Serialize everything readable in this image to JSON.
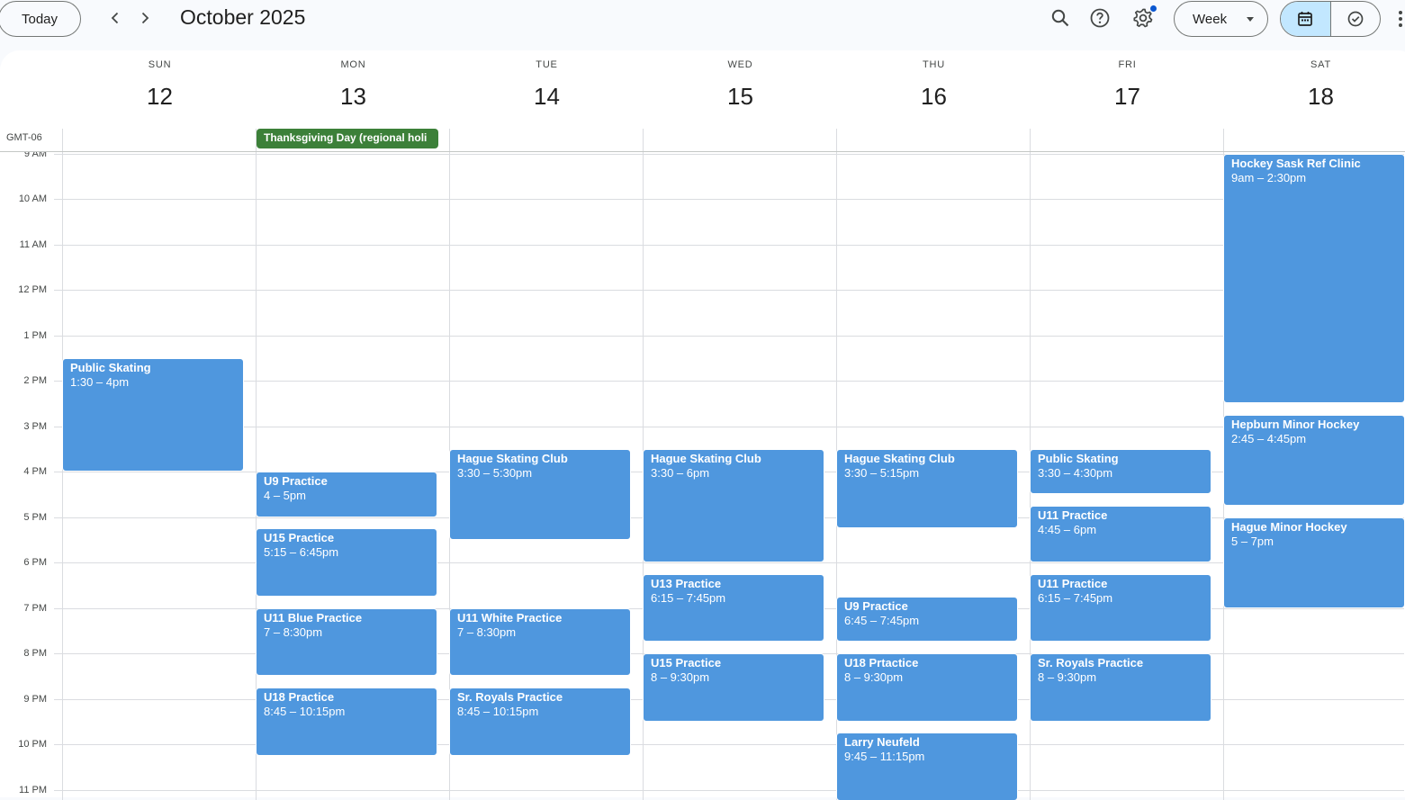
{
  "header": {
    "today_label": "Today",
    "month_title": "October 2025",
    "view_label": "Week"
  },
  "timezone": "GMT-06",
  "days": [
    {
      "dow": "SUN",
      "num": "12"
    },
    {
      "dow": "MON",
      "num": "13"
    },
    {
      "dow": "TUE",
      "num": "14"
    },
    {
      "dow": "WED",
      "num": "15"
    },
    {
      "dow": "THU",
      "num": "16"
    },
    {
      "dow": "FRI",
      "num": "17"
    },
    {
      "dow": "SAT",
      "num": "18"
    }
  ],
  "hours": [
    "9 AM",
    "10 AM",
    "11 AM",
    "12 PM",
    "1 PM",
    "2 PM",
    "3 PM",
    "4 PM",
    "5 PM",
    "6 PM",
    "7 PM",
    "8 PM",
    "9 PM",
    "10 PM",
    "11 PM"
  ],
  "all_day_events": [
    {
      "day": 1,
      "title": "Thanksgiving Day (regional holi",
      "color": "#3c8039"
    }
  ],
  "events": [
    {
      "day": 0,
      "title": "Public Skating",
      "time": "1:30 – 4pm",
      "start": 13.5,
      "end": 16.0
    },
    {
      "day": 1,
      "title": "U9 Practice",
      "time": "4 – 5pm",
      "start": 16.0,
      "end": 17.0
    },
    {
      "day": 1,
      "title": "U15 Practice",
      "time": "5:15 – 6:45pm",
      "start": 17.25,
      "end": 18.75
    },
    {
      "day": 1,
      "title": "U11 Blue Practice",
      "time": "7 – 8:30pm",
      "start": 19.0,
      "end": 20.5
    },
    {
      "day": 1,
      "title": "U18 Practice",
      "time": "8:45 – 10:15pm",
      "start": 20.75,
      "end": 22.25
    },
    {
      "day": 2,
      "title": "Hague Skating Club",
      "time": "3:30 – 5:30pm",
      "start": 15.5,
      "end": 17.5
    },
    {
      "day": 2,
      "title": "U11 White Practice",
      "time": "7 – 8:30pm",
      "start": 19.0,
      "end": 20.5
    },
    {
      "day": 2,
      "title": "Sr. Royals Practice",
      "time": "8:45 – 10:15pm",
      "start": 20.75,
      "end": 22.25
    },
    {
      "day": 3,
      "title": "Hague Skating Club",
      "time": "3:30 – 6pm",
      "start": 15.5,
      "end": 18.0
    },
    {
      "day": 3,
      "title": "U13 Practice",
      "time": "6:15 – 7:45pm",
      "start": 18.25,
      "end": 19.75
    },
    {
      "day": 3,
      "title": "U15 Practice",
      "time": "8 – 9:30pm",
      "start": 20.0,
      "end": 21.5
    },
    {
      "day": 4,
      "title": "Hague Skating Club",
      "time": "3:30 – 5:15pm",
      "start": 15.5,
      "end": 17.25
    },
    {
      "day": 4,
      "title": "U9 Practice",
      "time": "6:45 – 7:45pm",
      "start": 18.75,
      "end": 19.75
    },
    {
      "day": 4,
      "title": "U18 Prtactice",
      "time": "8 – 9:30pm",
      "start": 20.0,
      "end": 21.5
    },
    {
      "day": 4,
      "title": "Larry Neufeld",
      "time": "9:45 – 11:15pm",
      "start": 21.75,
      "end": 23.25
    },
    {
      "day": 5,
      "title": "Public Skating",
      "time": "3:30 – 4:30pm",
      "start": 15.5,
      "end": 16.5
    },
    {
      "day": 5,
      "title": "U11 Practice",
      "time": "4:45 – 6pm",
      "start": 16.75,
      "end": 18.0
    },
    {
      "day": 5,
      "title": "U11 Practice",
      "time": "6:15 – 7:45pm",
      "start": 18.25,
      "end": 19.75
    },
    {
      "day": 5,
      "title": "Sr. Royals Practice",
      "time": "8 – 9:30pm",
      "start": 20.0,
      "end": 21.5
    },
    {
      "day": 6,
      "title": "Hockey Sask Ref Clinic",
      "time": "9am – 2:30pm",
      "start": 9.0,
      "end": 14.5
    },
    {
      "day": 6,
      "title": "Hepburn Minor Hockey",
      "time": "2:45 – 4:45pm",
      "start": 14.75,
      "end": 16.75
    },
    {
      "day": 6,
      "title": "Hague Minor Hockey",
      "time": "5 – 7pm",
      "start": 17.0,
      "end": 19.0
    }
  ],
  "colors": {
    "event": "#4f97de",
    "holiday": "#3c8039",
    "accent": "#0b57d0",
    "toggle_active": "#c2e7ff"
  },
  "icons": [
    "chevron-left-icon",
    "chevron-right-icon",
    "search-icon",
    "help-icon",
    "settings-icon",
    "calendar-icon",
    "tasks-check-icon",
    "more-vert-icon"
  ]
}
